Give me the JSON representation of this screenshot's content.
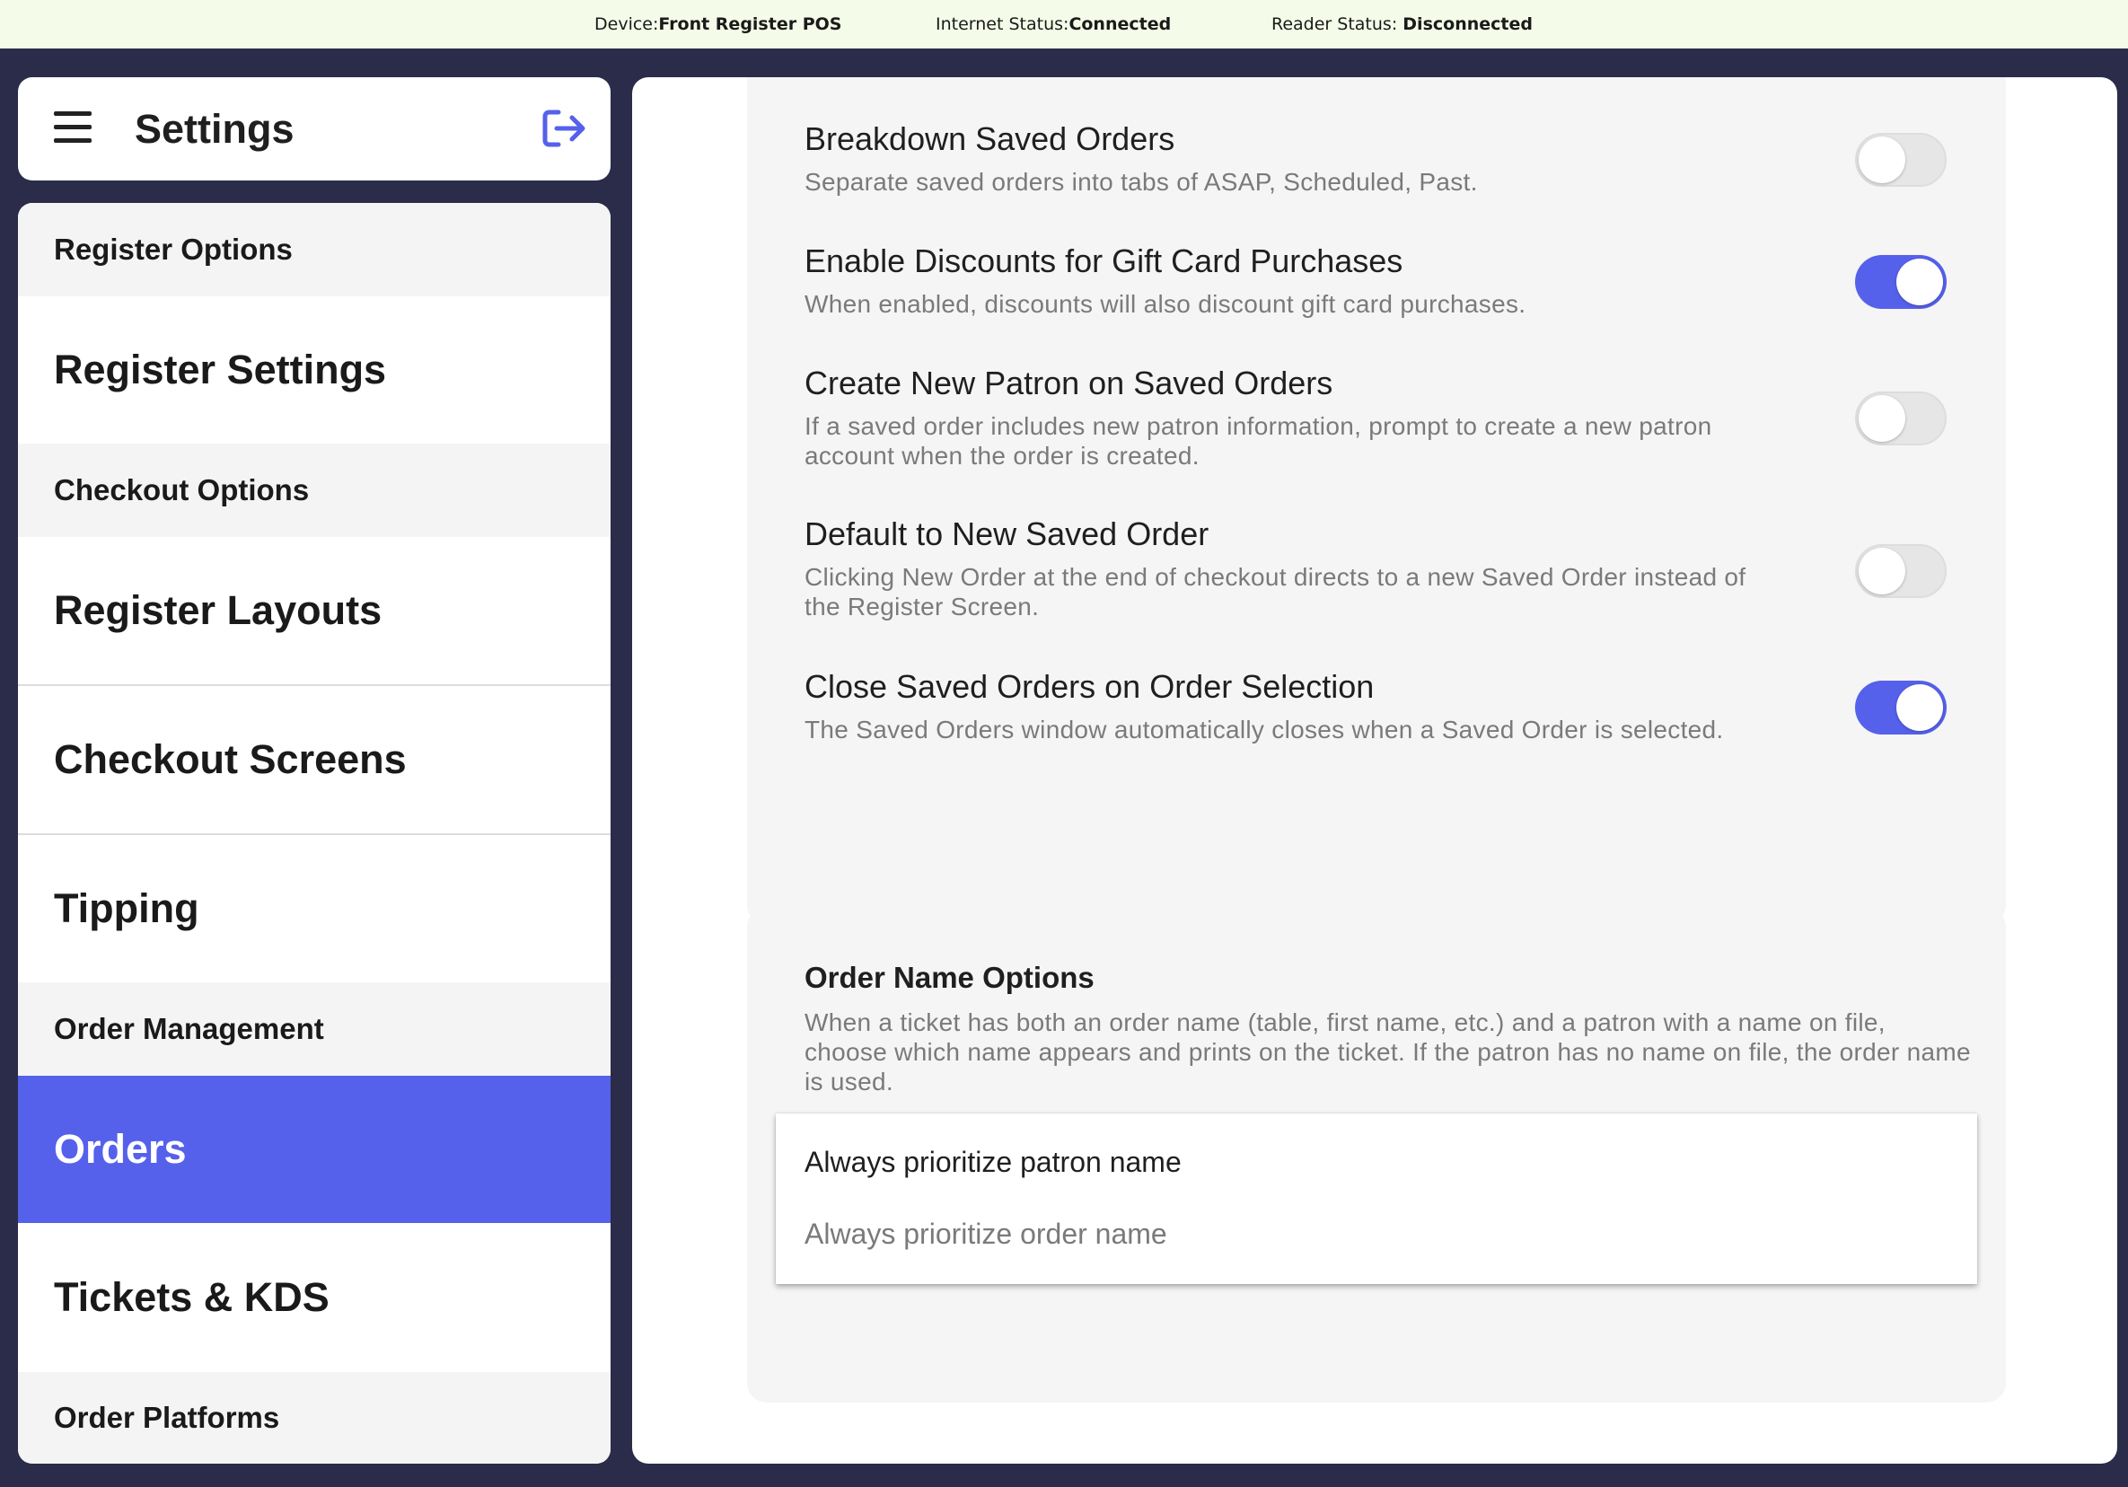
{
  "status_bar": {
    "device_label": "Device:",
    "device_value": "Front Register POS",
    "internet_label": "Internet Status:",
    "internet_value": "Connected",
    "reader_label": "Reader Status: ",
    "reader_value": "Disconnected"
  },
  "sidebar": {
    "title": "Settings",
    "menu_icon": "hamburger-icon",
    "logout_icon": "logout-icon",
    "items": [
      {
        "label": "Register Options",
        "kind": "section"
      },
      {
        "label": "Register Settings",
        "kind": "item"
      },
      {
        "label": "Checkout Options",
        "kind": "section"
      },
      {
        "label": "Register Layouts",
        "kind": "item"
      },
      {
        "label": "Checkout Screens",
        "kind": "item"
      },
      {
        "label": "Tipping",
        "kind": "item"
      },
      {
        "label": "Order Management",
        "kind": "section"
      },
      {
        "label": "Orders",
        "kind": "item",
        "active": true
      },
      {
        "label": "Tickets & KDS",
        "kind": "item"
      },
      {
        "label": "Order Platforms",
        "kind": "section"
      }
    ]
  },
  "settings": [
    {
      "title": "Breakdown Saved Orders",
      "description": "Separate saved orders into tabs of ASAP, Scheduled, Past.",
      "enabled": false
    },
    {
      "title": "Enable Discounts for Gift Card Purchases",
      "description": "When enabled, discounts will also discount gift card purchases.",
      "enabled": true
    },
    {
      "title": "Create New Patron on Saved Orders",
      "description": "If a saved order includes new patron information, prompt to create a new patron account when the order is created.",
      "enabled": false
    },
    {
      "title": "Default to New Saved Order",
      "description": "Clicking New Order at the end of checkout directs to a new Saved Order instead of the Register Screen.",
      "enabled": false
    },
    {
      "title": "Close Saved Orders on Order Selection",
      "description": "The Saved Orders window automatically closes when a Saved Order is selected.",
      "enabled": true
    }
  ],
  "order_name_options": {
    "title": "Order Name Options",
    "description": "When a ticket has both an order name (table, first name, etc.) and a patron with a name on file, choose which name appears and prints on the ticket. If the patron has no name on file, the order name is used.",
    "options": [
      {
        "label": "Always prioritize patron name",
        "selected": true
      },
      {
        "label": "Always prioritize order name",
        "selected": false
      }
    ]
  },
  "colors": {
    "accent": "#5561eb",
    "background": "#2a2c4a",
    "status_bar": "#f4fbe8"
  }
}
